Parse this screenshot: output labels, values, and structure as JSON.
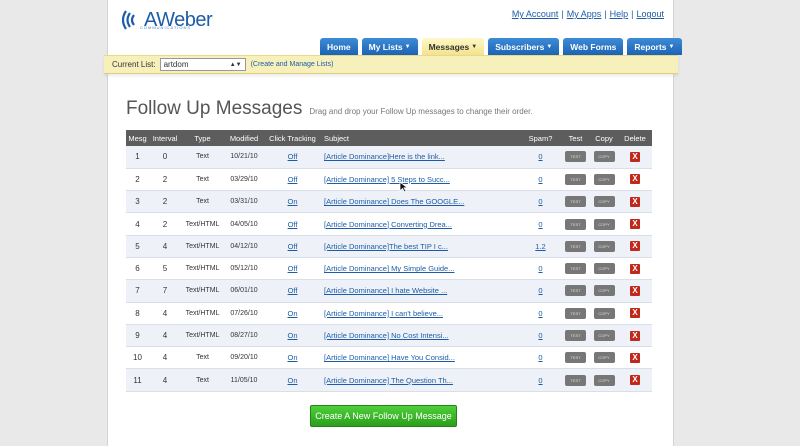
{
  "brand": {
    "name": "AWeber",
    "tagline": "COMMUNICATIONS"
  },
  "top_links": [
    "My Account",
    "My Apps",
    "Help",
    "Logout"
  ],
  "nav_tabs": [
    {
      "label": "Home",
      "has_menu": false,
      "active": false
    },
    {
      "label": "My Lists",
      "has_menu": true,
      "active": false
    },
    {
      "label": "Messages",
      "has_menu": true,
      "active": true
    },
    {
      "label": "Subscribers",
      "has_menu": true,
      "active": false
    },
    {
      "label": "Web Forms",
      "has_menu": false,
      "active": false
    },
    {
      "label": "Reports",
      "has_menu": true,
      "active": false
    }
  ],
  "list_bar": {
    "label": "Current List:",
    "selected": "artdom",
    "manage_link": "(Create and Manage Lists)"
  },
  "page": {
    "title": "Follow Up Messages",
    "subtitle": "Drag and drop your Follow Up messages to change their order."
  },
  "table": {
    "headers": [
      "Mesg",
      "Interval",
      "Type",
      "Modified",
      "Click Tracking",
      "Subject",
      "Spam?",
      "Test",
      "Copy",
      "Delete"
    ],
    "button_labels": {
      "test": "TEST",
      "copy": "COPY",
      "delete": "X"
    },
    "rows": [
      {
        "mesg": "1",
        "interval": "0",
        "type": "Text",
        "modified": "10/21/10",
        "tracking": "Off",
        "subject": "[Article Dominance]Here is the link...",
        "spam": "0"
      },
      {
        "mesg": "2",
        "interval": "2",
        "type": "Text",
        "modified": "03/29/10",
        "tracking": "Off",
        "subject": "[Article Dominance] 5 Steps to Succ...",
        "spam": "0"
      },
      {
        "mesg": "3",
        "interval": "2",
        "type": "Text",
        "modified": "03/31/10",
        "tracking": "On",
        "subject": "[Article Dominance] Does The GOOGLE...",
        "spam": "0"
      },
      {
        "mesg": "4",
        "interval": "2",
        "type": "Text/HTML",
        "modified": "04/05/10",
        "tracking": "Off",
        "subject": "[Article Dominance] Converting Drea...",
        "spam": "0"
      },
      {
        "mesg": "5",
        "interval": "4",
        "type": "Text/HTML",
        "modified": "04/12/10",
        "tracking": "Off",
        "subject": "[Article Dominance]The best TIP I c...",
        "spam": "1.2"
      },
      {
        "mesg": "6",
        "interval": "5",
        "type": "Text/HTML",
        "modified": "05/12/10",
        "tracking": "Off",
        "subject": "[Article Dominance] My Simple Guide...",
        "spam": "0"
      },
      {
        "mesg": "7",
        "interval": "7",
        "type": "Text/HTML",
        "modified": "06/01/10",
        "tracking": "Off",
        "subject": "[Article Dominance] I hate Website ...",
        "spam": "0"
      },
      {
        "mesg": "8",
        "interval": "4",
        "type": "Text/HTML",
        "modified": "07/26/10",
        "tracking": "On",
        "subject": "[Article Dominance] I can't believe...",
        "spam": "0"
      },
      {
        "mesg": "9",
        "interval": "4",
        "type": "Text/HTML",
        "modified": "08/27/10",
        "tracking": "On",
        "subject": "[Article Dominance] No Cost Intensi...",
        "spam": "0"
      },
      {
        "mesg": "10",
        "interval": "4",
        "type": "Text",
        "modified": "09/20/10",
        "tracking": "On",
        "subject": "[Article Dominance] Have You Consid...",
        "spam": "0"
      },
      {
        "mesg": "11",
        "interval": "4",
        "type": "Text",
        "modified": "11/05/10",
        "tracking": "On",
        "subject": "[Article Dominance] The Question Th...",
        "spam": "0"
      }
    ]
  },
  "create_button": "Create A New Follow Up Message",
  "colors": {
    "brand_blue": "#1d5da8",
    "tab_blue": "#2b74c4",
    "active_tab": "#f3e38d",
    "header_gray": "#5d5d5d",
    "create_green": "#3bb52a",
    "delete_red": "#c0281c"
  }
}
